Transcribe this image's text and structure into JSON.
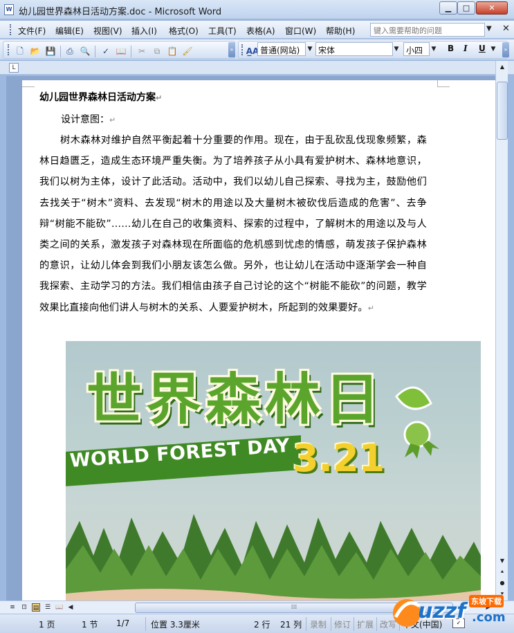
{
  "window": {
    "title": "幼儿园世界森林日活动方案.doc - Microsoft Word",
    "doc_icon_label": "W",
    "minimize": "▁",
    "maximize": "□",
    "close": "✕"
  },
  "menu": {
    "items": [
      "文件(F)",
      "编辑(E)",
      "视图(V)",
      "插入(I)",
      "格式(O)",
      "工具(T)",
      "表格(A)",
      "窗口(W)",
      "帮助(H)"
    ],
    "help_placeholder": "键入需要帮助的问题",
    "close_doc": "✕"
  },
  "toolbar": {
    "style_value": "普通(网站)",
    "font_value": "宋体",
    "size_value": "小四",
    "bold": "B",
    "italic": "I",
    "underline": "U",
    "style_icon": "A̲A"
  },
  "ruler": {
    "tab_marker": "L"
  },
  "document": {
    "title": "幼儿园世界森林日活动方案",
    "subhead": "设计意图：",
    "paragraph": "树木森林对维护自然平衡起着十分重要的作用。现在，由于乱砍乱伐现象频繁，森林日趋匮乏，造成生态环境严重失衡。为了培养孩子从小具有爱护树木、森林地意识，我们以树为主体，设计了此活动。活动中，我们以幼儿自己探索、寻找为主，鼓励他们去找关于“树木”资料、去发现“树木的用途以及大量树木被砍伐后造成的危害”、去争辩“树能不能砍”……幼儿在自己的收集资料、探索的过程中，了解树木的用途以及与人类之间的关系，激发孩子对森林现在所面临的危机感到忧虑的情感，萌发孩子保护森林的意识，让幼儿体会到我们小朋友该怎么做。另外，也让幼儿在活动中逐渐学会一种自我探索、主动学习的方法。我们相信由孩子自己讨论的这个“树能不能砍”的问题，教学效果比直接向他们讲人与树木的关系、人要爱护树木，所起到的效果要好。",
    "para_mark": "↵",
    "picture": {
      "title": "世界森林日",
      "banner": "WORLD FOREST DAY",
      "date": "3.21"
    }
  },
  "status": {
    "page": "1 页",
    "section": "1 节",
    "page_of": "1/7",
    "position": "位置 3.3厘米",
    "line": "2 行",
    "column": "21 列",
    "rec": "录制",
    "trk": "修订",
    "ext": "扩展",
    "ovr": "改写",
    "lang": "中文(中国)"
  },
  "watermark": {
    "brand": "uzzf",
    "tagline": "东坡下载",
    "domain": ".com"
  }
}
